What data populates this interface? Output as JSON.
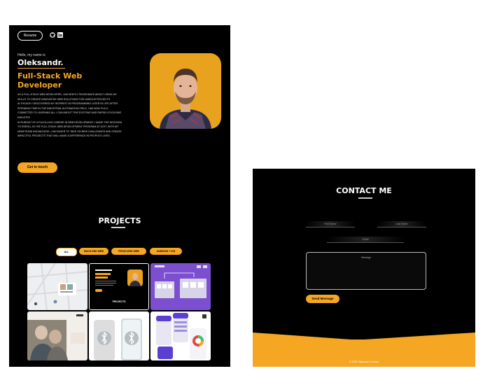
{
  "header": {
    "resume_label": "Resume",
    "icons": [
      "github-icon",
      "linkedin-icon"
    ]
  },
  "hero": {
    "greeting": "Hello, my name is",
    "name": "Oleksandr.",
    "role_line1": "Full-Stack Web",
    "role_line2": "Developer",
    "bio_paragraphs": [
      "As a full-stack web developer, I am deeply passionate about using my skills to create innovative web solutions for various projects. Although I discovered my interest in programming later in life after spending time in the industrial automation field, I am now fully committed to learning all I can about this exciting and rapidly-evolving industry.",
      "In pursuit of a fulfilling career in web development, I made the decision to enroll in the full-stack web development program at GoIT. With my newfound knowledge, I am eager to take on new challenges and create impactful projects that will make a difference in people's lives."
    ],
    "cta_label": "Get in touch"
  },
  "projects": {
    "title": "PROJECTS",
    "filters": [
      "All",
      "Back-end web",
      "Front-end web",
      "Android + iOS"
    ],
    "active_filter": "All",
    "card_inner_title": "PROJECTS"
  },
  "contact": {
    "title": "CONTACT ME",
    "first_name_placeholder": "First Name",
    "last_name_placeholder": "Last Name",
    "email_placeholder": "Email",
    "message_placeholder": "Message",
    "send_label": "Send Message",
    "footer_text": "© 2023 Oleksandr Levchuk"
  },
  "colors": {
    "accent": "#f5a623",
    "background": "#000000",
    "text": "#ffffff"
  }
}
